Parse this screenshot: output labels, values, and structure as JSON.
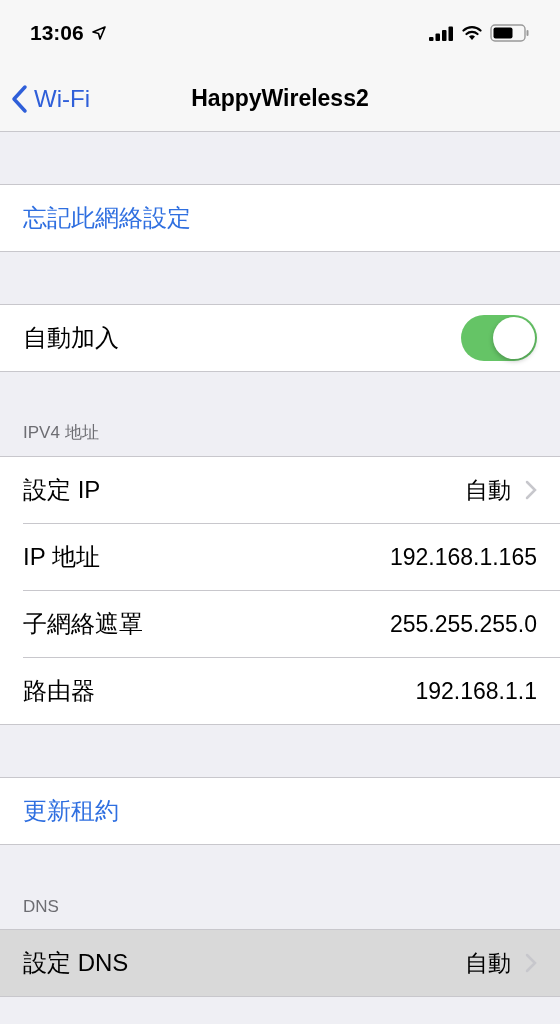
{
  "status_bar": {
    "time": "13:06"
  },
  "nav_bar": {
    "back_label": "Wi-Fi",
    "title": "HappyWireless2"
  },
  "sections": [
    {
      "rows": [
        {
          "kind": "action",
          "label": "忘記此網絡設定",
          "selected": false
        }
      ]
    },
    {
      "rows": [
        {
          "kind": "toggle",
          "label": "自動加入",
          "on": true,
          "selected": false
        }
      ]
    },
    {
      "header": "IPV4 地址",
      "rows": [
        {
          "kind": "detail",
          "label": "設定 IP",
          "value": "自動",
          "selected": false
        },
        {
          "kind": "value",
          "label": "IP 地址",
          "value": "192.168.1.165",
          "selected": false
        },
        {
          "kind": "value",
          "label": "子網絡遮罩",
          "value": "255.255.255.0",
          "selected": false
        },
        {
          "kind": "value",
          "label": "路由器",
          "value": "192.168.1.1",
          "selected": false
        }
      ]
    },
    {
      "rows": [
        {
          "kind": "action",
          "label": "更新租約",
          "selected": false
        }
      ]
    },
    {
      "header": "DNS",
      "rows": [
        {
          "kind": "detail",
          "label": "設定 DNS",
          "value": "自動",
          "selected": true
        }
      ]
    }
  ]
}
